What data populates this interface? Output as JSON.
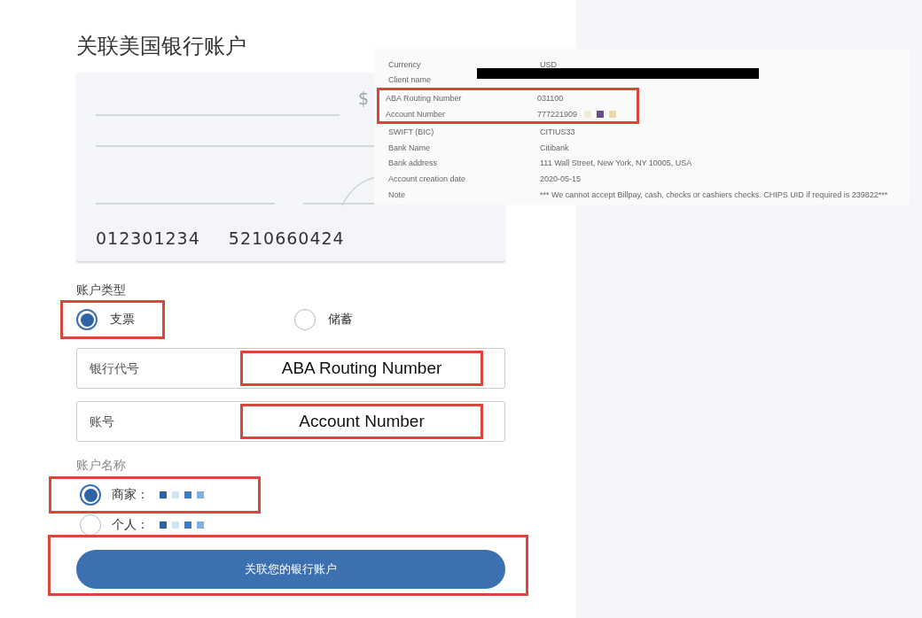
{
  "page": {
    "title": "关联美国银行账户"
  },
  "check_image": {
    "currency_sign": "$",
    "routing_number": "012301234",
    "account_number": "5210660424"
  },
  "account_type": {
    "label": "账户类型",
    "options": [
      {
        "label": "支票",
        "selected": true,
        "highlighted": true
      },
      {
        "label": "储蓄",
        "selected": false,
        "highlighted": false
      }
    ]
  },
  "fields": [
    {
      "placeholder": "银行代号",
      "annotation": "ABA Routing Number"
    },
    {
      "placeholder": "账号",
      "annotation": "Account Number"
    }
  ],
  "account_name": {
    "label": "账户名称",
    "options": [
      {
        "label": "商家：",
        "selected": true,
        "highlighted": true,
        "redacted": true
      },
      {
        "label": "个人：",
        "selected": false,
        "highlighted": false,
        "redacted": true
      }
    ]
  },
  "button": {
    "label": "关联您的银行账户",
    "highlighted": true
  },
  "details": {
    "rows": [
      {
        "label": "Currency",
        "value": "USD",
        "highlighted": false
      },
      {
        "label": "Client name",
        "redacted": true,
        "highlighted": false
      },
      {
        "label": "ABA Routing Number",
        "value": "031100",
        "highlighted": true
      },
      {
        "label": "Account Number",
        "value": "777221909",
        "blurred": true,
        "highlighted": true
      },
      {
        "label": "SWIFT (BIC)",
        "value": "CITIUS33",
        "highlighted": false
      },
      {
        "label": "Bank Name",
        "value": "Citibank",
        "highlighted": false
      },
      {
        "label": "Bank address",
        "value": "111 Wall Street, New York, NY 10005, USA",
        "highlighted": false
      },
      {
        "label": "Account creation date",
        "value": "2020-05-15",
        "highlighted": false
      },
      {
        "label": "Note",
        "value": "*** We cannot accept Billpay, cash, checks or cashiers checks. CHIPS UID if required is 239822***",
        "highlighted": false
      }
    ]
  }
}
